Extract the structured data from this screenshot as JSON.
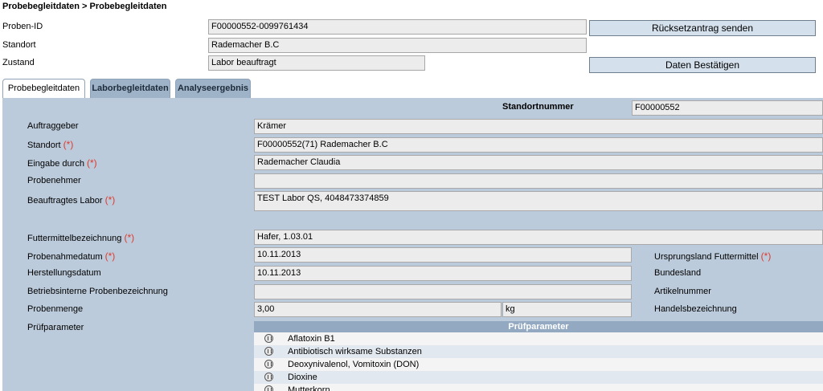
{
  "breadcrumb": "Probebegleitdaten > Probebegleitdaten",
  "header": {
    "proben_id_label": "Proben-ID",
    "proben_id_value": "F00000552-0099761434",
    "standort_label": "Standort",
    "standort_value": "Rademacher B.C",
    "zustand_label": "Zustand",
    "zustand_value": "Labor beauftragt",
    "reset_button": "Rücksetzantrag senden",
    "confirm_button": "Daten Bestätigen"
  },
  "tabs": [
    {
      "label": "Probebegleitdaten",
      "active": true
    },
    {
      "label": "Laborbegleitdaten",
      "active": false
    },
    {
      "label": "Analyseergebnis",
      "active": false
    }
  ],
  "form": {
    "standortnummer_label": "Standortnummer",
    "standortnummer_value": "F00000552",
    "auftraggeber_label": "Auftraggeber",
    "auftraggeber_value": "Krämer",
    "standort_label": "Standort",
    "standort_value": "F00000552(71) Rademacher B.C",
    "eingabe_label": "Eingabe durch",
    "eingabe_value": "Rademacher Claudia",
    "probenehmer_label": "Probenehmer",
    "probenehmer_value": "",
    "labor_label": "Beauftragtes Labor",
    "labor_value": "TEST Labor QS, 4048473374859",
    "futtermittel_label": "Futtermittelbezeichnung",
    "futtermittel_value": "Hafer, 1.03.01",
    "probenahmedatum_label": "Probenahmedatum",
    "probenahmedatum_value": "10.11.2013",
    "herstellungsdatum_label": "Herstellungsdatum",
    "herstellungsdatum_value": "10.11.2013",
    "betriebsintern_label": "Betriebsinterne Probenbezeichnung",
    "betriebsintern_value": "",
    "probenmenge_label": "Probenmenge",
    "probenmenge_value": "3,00",
    "probenmenge_unit": "kg",
    "ursprungsland_label": "Ursprungsland Futtermittel",
    "bundesland_label": "Bundesland",
    "artikelnummer_label": "Artikelnummer",
    "handelsbezeichnung_label": "Handelsbezeichnung",
    "pruefparameter_label": "Prüfparameter",
    "required_marker": "(*)"
  },
  "pruefparameter": {
    "header": "Prüfparameter",
    "items": [
      "Aflatoxin B1",
      "Antibiotisch wirksame Substanzen",
      "Deoxynivalenol, Vomitoxin (DON)",
      "Dioxine",
      "Mutterkorn"
    ]
  }
}
